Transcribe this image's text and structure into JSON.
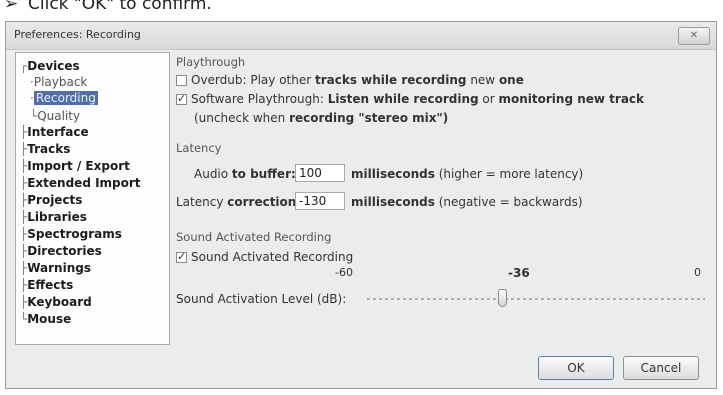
{
  "caption": {
    "bullet": "➢",
    "text": "Click \"OK\" to confirm."
  },
  "window": {
    "title": "Preferences: Recording",
    "close_label": "✕"
  },
  "tree": {
    "connector_top": "┌",
    "connector_mid": "├",
    "connector_last": "└",
    "connector_child": "·",
    "items": [
      {
        "label": "Devices",
        "level": 0
      },
      {
        "label": "Playback",
        "level": 1
      },
      {
        "label": "Recording",
        "level": 1,
        "selected": true
      },
      {
        "label": "Quality",
        "level": 1
      },
      {
        "label": "Interface",
        "level": 0
      },
      {
        "label": "Tracks",
        "level": 0
      },
      {
        "label": "Import / Export",
        "level": 0
      },
      {
        "label": "Extended Import",
        "level": 0
      },
      {
        "label": "Projects",
        "level": 0
      },
      {
        "label": "Libraries",
        "level": 0
      },
      {
        "label": "Spectrograms",
        "level": 0
      },
      {
        "label": "Directories",
        "level": 0
      },
      {
        "label": "Warnings",
        "level": 0
      },
      {
        "label": "Effects",
        "level": 0
      },
      {
        "label": "Keyboard",
        "level": 0
      },
      {
        "label": "Mouse",
        "level": 0
      }
    ]
  },
  "playthrough": {
    "heading": "Playthrough",
    "overdub": {
      "label_a": "Overdub: Play other ",
      "label_b": "tracks while recording",
      "label_c": " new ",
      "label_d": "one",
      "checked": false
    },
    "software": {
      "label_a": "Software Playthrough: ",
      "label_b": "Listen while recording",
      "label_c": " or ",
      "label_d": "monitoring new track",
      "checked": true
    },
    "note_a": "(uncheck when ",
    "note_b": "recording \"stereo mix\")"
  },
  "latency": {
    "heading": "Latency",
    "buffer_label_a": "Audio ",
    "buffer_label_b": "to buffer:",
    "buffer_value": "100",
    "buffer_unit_a": "milliseconds",
    "buffer_unit_b": " (higher = more latency)",
    "correction_label_a": "Latency ",
    "correction_label_b": "correction:",
    "correction_value": "-130",
    "correction_unit_a": "milliseconds",
    "correction_unit_b": " (negative = backwards)"
  },
  "sound_activated": {
    "heading": "Sound Activated Recording",
    "checkbox_label": "Sound Activated Recording",
    "checked": true,
    "level_label": "Sound Activation Level (dB):",
    "min_label": "-60",
    "value_label": "-36",
    "max_label": "0",
    "level_fraction": 0.4
  },
  "buttons": {
    "ok": "OK",
    "cancel": "Cancel"
  }
}
